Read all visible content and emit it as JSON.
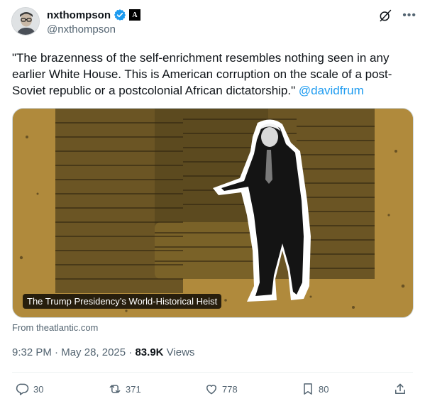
{
  "author": {
    "display_name": "nxthompson",
    "handle": "@nxthompson",
    "verified_icon": "verified-badge-icon",
    "affiliation_icon": "the-atlantic-logo-icon",
    "affiliation_glyph": "A"
  },
  "tweet": {
    "text": "\"The brazenness of the self-enrichment resembles nothing seen in any earlier White House. This is American corruption on the scale of a post-Soviet republic or a postcolonial African dictatorship.\" ",
    "mention": "@davidfrum"
  },
  "card": {
    "title": "The Trump Presidency’s World-Historical Heist",
    "source": "From theatlantic.com"
  },
  "meta": {
    "time": "9:32 PM",
    "separator": " · ",
    "date": "May 28, 2025",
    "separator2": " · ",
    "views_count": "83.9K",
    "views_label": " Views"
  },
  "actions": {
    "replies": "30",
    "reposts": "371",
    "likes": "778",
    "bookmarks": "80"
  },
  "colors": {
    "accent": "#1d9bf0",
    "secondary_text": "#536471",
    "card_background": "#b08a3c"
  }
}
